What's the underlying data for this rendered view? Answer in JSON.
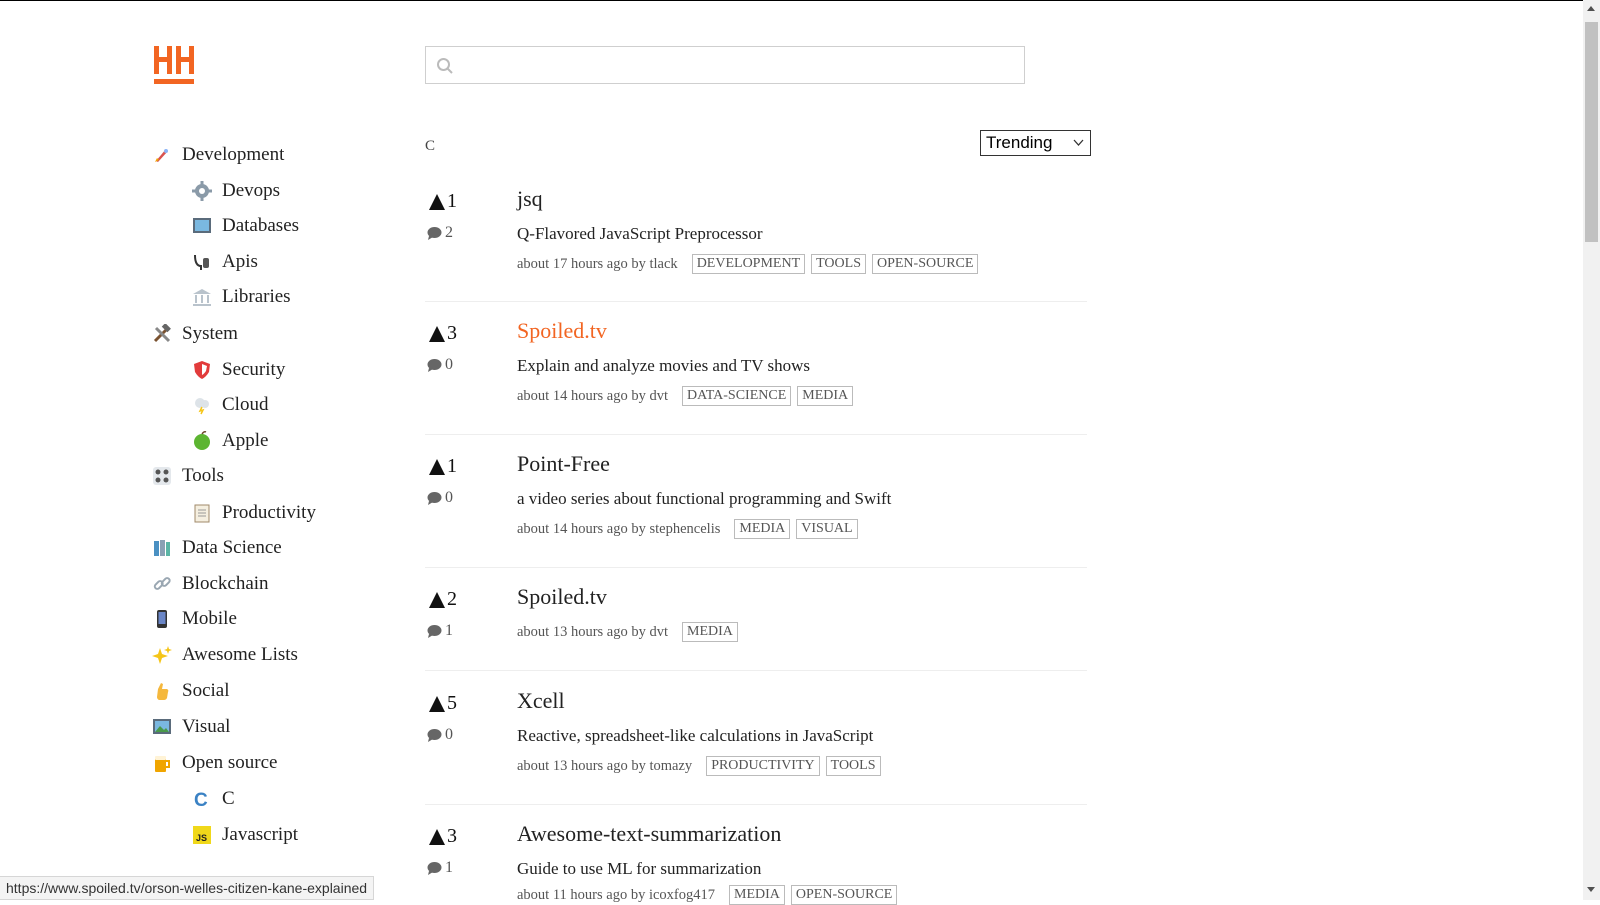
{
  "colors": {
    "brand": "#f26522",
    "text": "#222222",
    "muted": "#555555",
    "border": "#bbbbbb"
  },
  "header": {
    "logo": "HH-logo",
    "search_placeholder": ""
  },
  "breadcrumb": "C",
  "sort": {
    "selected": "Trending"
  },
  "sidebar": {
    "items": [
      {
        "label": "Development",
        "icon": "rocket-icon",
        "level": 0
      },
      {
        "label": "Devops",
        "icon": "gear-icon",
        "level": 1
      },
      {
        "label": "Databases",
        "icon": "database-icon",
        "level": 1
      },
      {
        "label": "Apis",
        "icon": "plug-icon",
        "level": 1
      },
      {
        "label": "Libraries",
        "icon": "library-icon",
        "level": 1
      },
      {
        "label": "System",
        "icon": "hammer-wrench-icon",
        "level": 0
      },
      {
        "label": "Security",
        "icon": "shield-icon",
        "level": 1
      },
      {
        "label": "Cloud",
        "icon": "cloud-icon",
        "level": 1
      },
      {
        "label": "Apple",
        "icon": "apple-icon",
        "level": 1
      },
      {
        "label": "Tools",
        "icon": "tools-grid-icon",
        "level": 0
      },
      {
        "label": "Productivity",
        "icon": "clipboard-icon",
        "level": 1
      },
      {
        "label": "Data Science",
        "icon": "books-icon",
        "level": 0
      },
      {
        "label": "Blockchain",
        "icon": "link-icon",
        "level": 0
      },
      {
        "label": "Mobile",
        "icon": "phone-icon",
        "level": 0
      },
      {
        "label": "Awesome Lists",
        "icon": "sparkles-icon",
        "level": 0
      },
      {
        "label": "Social",
        "icon": "hand-icon",
        "level": 0
      },
      {
        "label": "Visual",
        "icon": "picture-icon",
        "level": 0
      },
      {
        "label": "Open source",
        "icon": "beer-icon",
        "level": 0
      },
      {
        "label": "C",
        "icon": "c-lang-icon",
        "level": 1
      },
      {
        "label": "Javascript",
        "icon": "js-icon",
        "level": 1
      }
    ]
  },
  "posts": [
    {
      "votes": "1",
      "comments": "2",
      "title": "jsq",
      "active": false,
      "desc": "Q-Flavored JavaScript Preprocessor",
      "meta": "about 17 hours ago by tlack",
      "tags": [
        "DEVELOPMENT",
        "TOOLS",
        "OPEN-SOURCE"
      ]
    },
    {
      "votes": "3",
      "comments": "0",
      "title": "Spoiled.tv",
      "active": true,
      "desc": "Explain and analyze movies and TV shows",
      "meta": "about 14 hours ago by dvt",
      "tags": [
        "DATA-SCIENCE",
        "MEDIA"
      ]
    },
    {
      "votes": "1",
      "comments": "0",
      "title": "Point-Free",
      "active": false,
      "desc": "a video series about functional programming and Swift",
      "meta": "about 14 hours ago by stephencelis",
      "tags": [
        "MEDIA",
        "VISUAL"
      ]
    },
    {
      "votes": "2",
      "comments": "1",
      "title": "Spoiled.tv",
      "active": false,
      "desc": "",
      "meta": "about 13 hours ago by dvt",
      "tags": [
        "MEDIA"
      ]
    },
    {
      "votes": "5",
      "comments": "0",
      "title": "Xcell",
      "active": false,
      "desc": "Reactive, spreadsheet-like calculations in JavaScript",
      "meta": "about 13 hours ago by tomazy",
      "tags": [
        "PRODUCTIVITY",
        "TOOLS"
      ]
    },
    {
      "votes": "3",
      "comments": "1",
      "title": "Awesome-text-summarization",
      "active": false,
      "desc": "Guide to use ML for summarization",
      "meta": "about 11 hours ago by icoxfog417",
      "tags": [
        "MEDIA",
        "OPEN-SOURCE"
      ]
    }
  ],
  "status_url": "https://www.spoiled.tv/orson-welles-citizen-kane-explained"
}
